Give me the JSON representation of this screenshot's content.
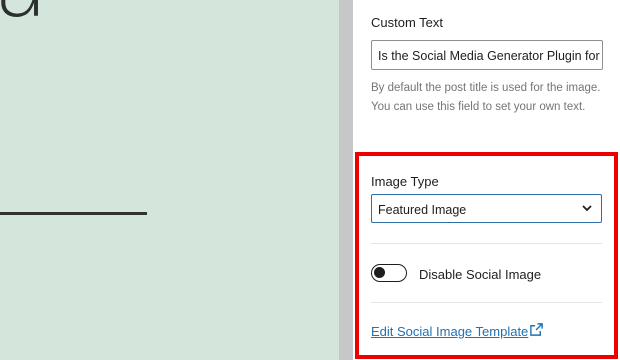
{
  "preview": {
    "glyph": "a"
  },
  "custom_text": {
    "label": "Custom Text",
    "value": "Is the Social Media Generator Plugin for",
    "help": "By default the post title is used for the image. You can use this field to set your own text."
  },
  "image_type": {
    "label": "Image Type",
    "selected": "Featured Image"
  },
  "social_toggle": {
    "label": "Disable Social Image",
    "enabled": false
  },
  "edit_link": {
    "label": "Edit Social Image Template",
    "icon": "external-link-icon"
  },
  "colors": {
    "highlight": "#ee0000",
    "link": "#2271b1",
    "preview_bg": "#d4e5dc",
    "select_border": "#2f6fa6"
  }
}
